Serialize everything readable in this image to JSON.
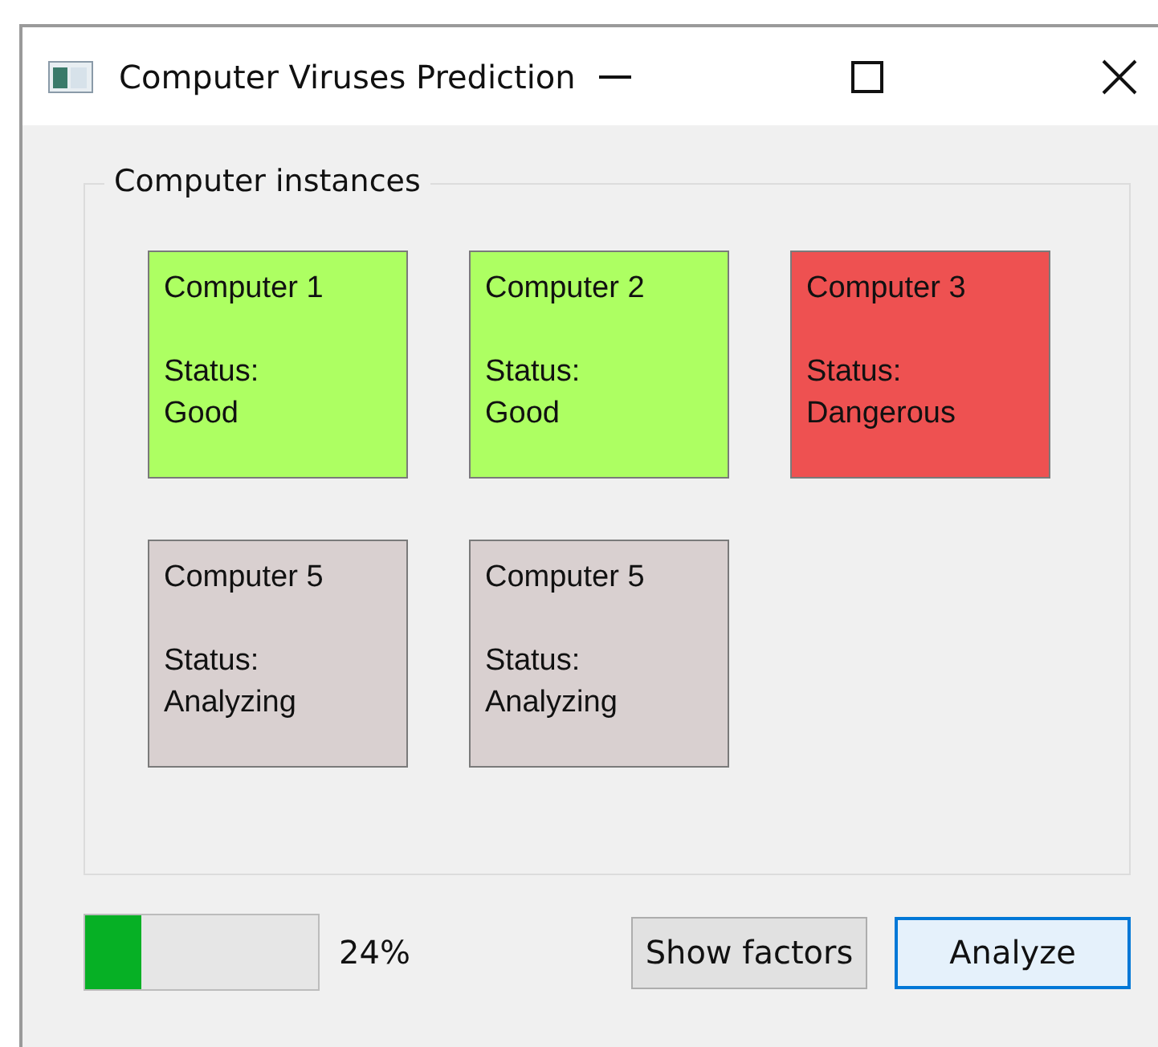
{
  "window": {
    "title": "Computer Viruses Prediction"
  },
  "group": {
    "title": "Computer instances"
  },
  "computers": [
    {
      "name": "Computer 1",
      "status_label": "Status:",
      "status": "Good",
      "color": "#adff62"
    },
    {
      "name": "Computer 2",
      "status_label": "Status:",
      "status": "Good",
      "color": "#adff62"
    },
    {
      "name": "Computer 3",
      "status_label": "Status:",
      "status": "Dangerous",
      "color": "#ee5151"
    },
    {
      "name": "Computer 5",
      "status_label": "Status:",
      "status": "Analyzing",
      "color": "#d9d0d0"
    },
    {
      "name": "Computer 5",
      "status_label": "Status:",
      "status": "Analyzing",
      "color": "#d9d0d0"
    }
  ],
  "progress": {
    "level": 0.24,
    "reading": "24%"
  },
  "buttons": [
    {
      "label": "Show factors",
      "kind": "normal"
    },
    {
      "label": "Analyze",
      "kind": "default"
    }
  ]
}
